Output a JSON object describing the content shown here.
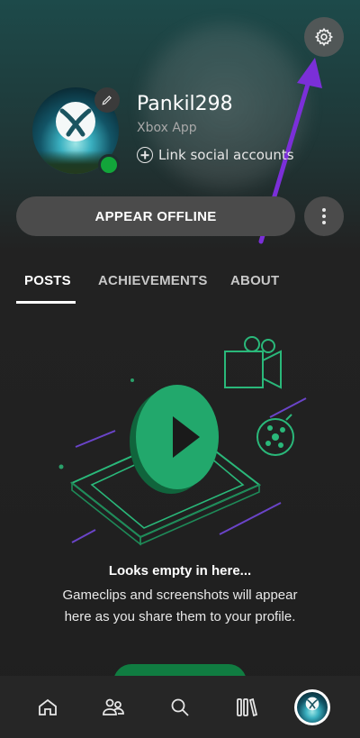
{
  "profile": {
    "gamertag": "Pankil298",
    "app_label": "Xbox App",
    "link_social": "Link social accounts"
  },
  "actions": {
    "appear_offline": "APPEAR OFFLINE"
  },
  "tabs": [
    {
      "label": "POSTS",
      "active": true
    },
    {
      "label": "ACHIEVEMENTS",
      "active": false
    },
    {
      "label": "ABOUT",
      "active": false
    }
  ],
  "empty_state": {
    "title": "Looks empty in here...",
    "description": "Gameclips and screenshots will appear here as you share them to your profile."
  },
  "bottom_nav": [
    {
      "name": "home-icon"
    },
    {
      "name": "friends-icon"
    },
    {
      "name": "search-icon"
    },
    {
      "name": "library-icon"
    },
    {
      "name": "profile-avatar-icon"
    }
  ],
  "colors": {
    "accent_green": "#107c41",
    "online": "#12a53a",
    "annotation_arrow": "#7b2fd8"
  }
}
